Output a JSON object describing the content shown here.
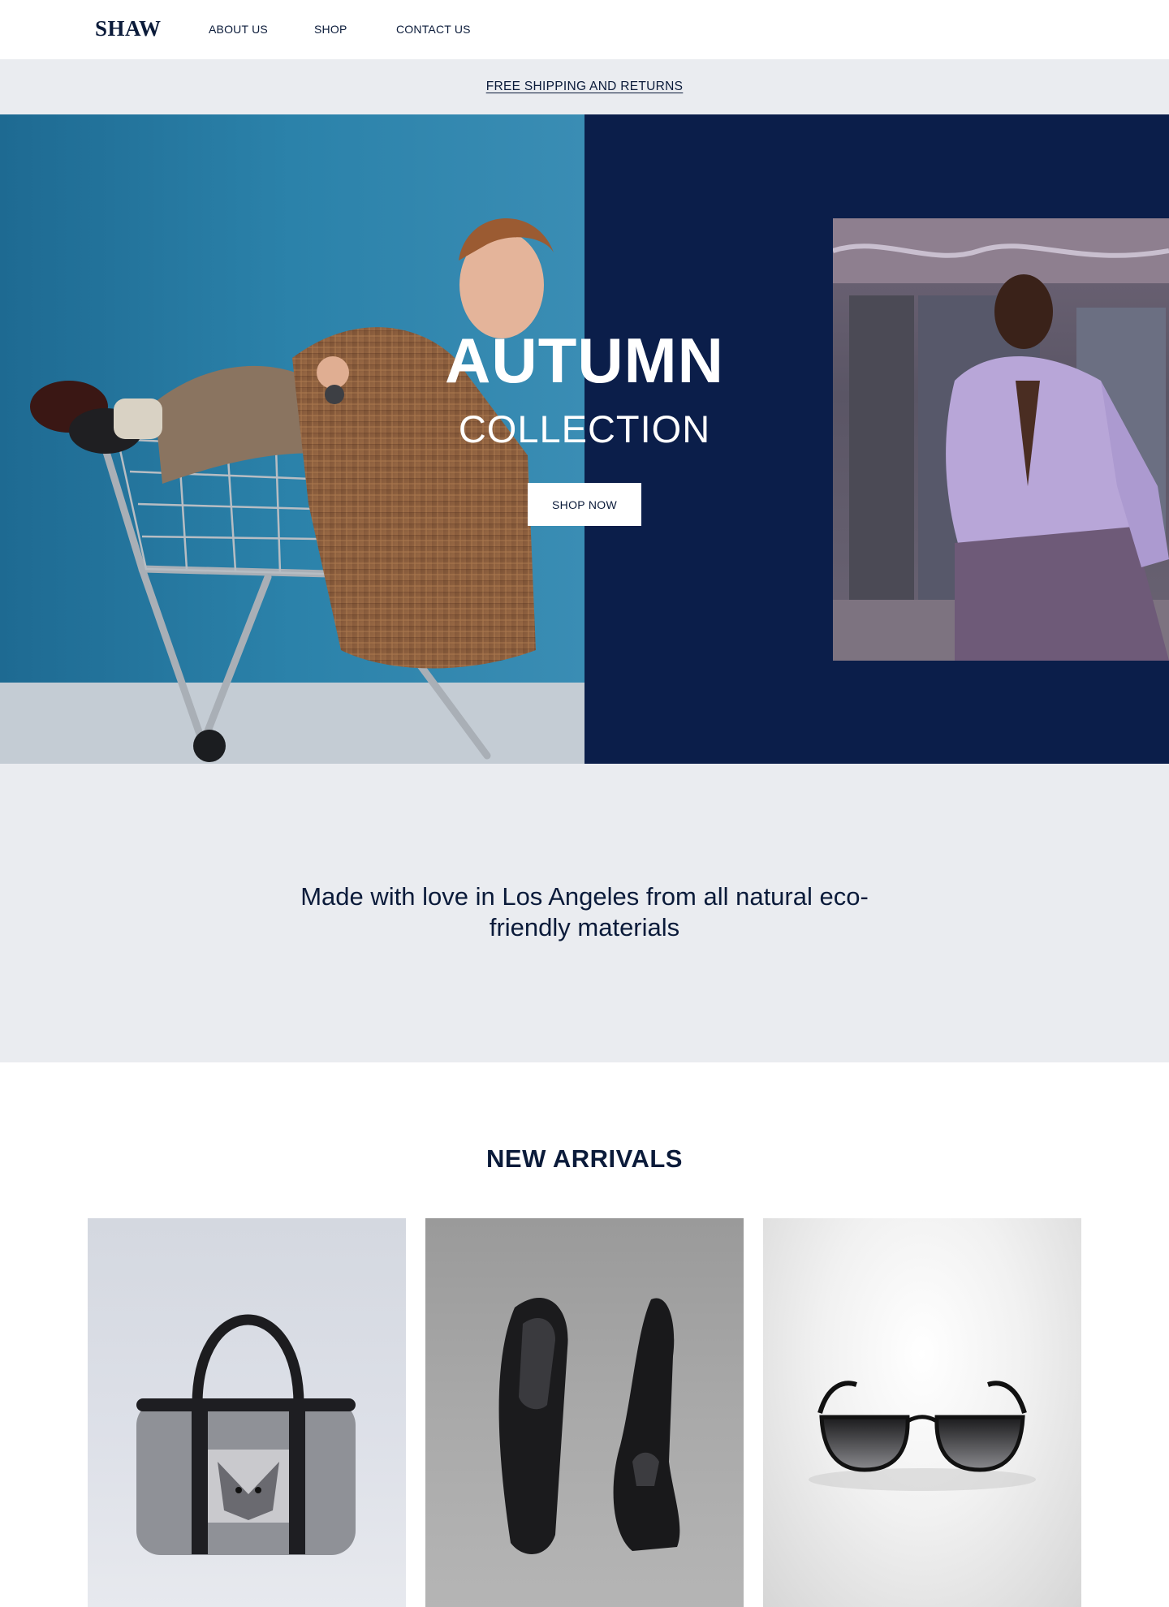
{
  "header": {
    "logo": "SHAW",
    "nav": [
      {
        "label": "ABOUT US"
      },
      {
        "label": "SHOP"
      },
      {
        "label": "CONTACT US"
      }
    ]
  },
  "announcement": {
    "text": "FREE SHIPPING AND RETURNS"
  },
  "hero": {
    "title": "AUTUMN",
    "subtitle": "COLLECTION",
    "cta_label": "SHOP NOW",
    "background_color": "#0b1e4a",
    "left_photo": "man-in-plaid-blazer-sitting-in-shopping-cart",
    "right_photo": "man-in-lavender-shirt-sitting"
  },
  "tagline": {
    "text": "Made with love in Los Angeles from all natural eco-friendly materials"
  },
  "new_arrivals": {
    "title": "NEW ARRIVALS",
    "products": [
      {
        "image": "gray-felt-duffel-bag-with-wolf"
      },
      {
        "image": "black-leather-loafers"
      },
      {
        "image": "black-sunglasses"
      }
    ]
  },
  "colors": {
    "navy": "#0b1e4a",
    "text": "#0b1b3a",
    "light_gray": "#eaecf0"
  }
}
